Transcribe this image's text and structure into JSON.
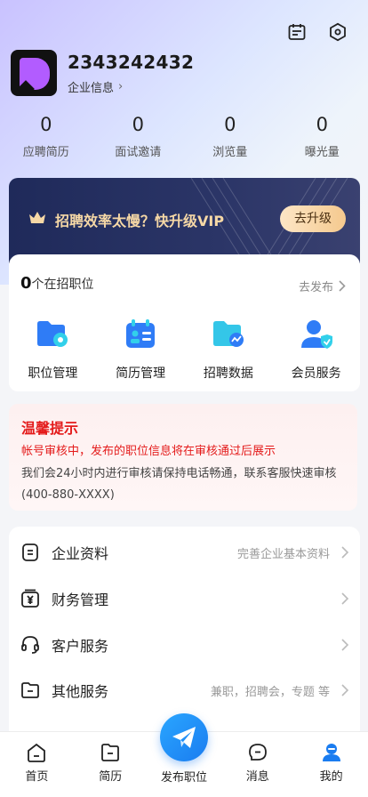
{
  "profile": {
    "company_name": "2343242432",
    "info_label": "企业信息",
    "info_chevron": "›"
  },
  "header_icons": [
    "calendar-icon",
    "settings-hexagon-icon"
  ],
  "stats": [
    {
      "value": "0",
      "label": "应聘简历"
    },
    {
      "value": "0",
      "label": "面试邀请"
    },
    {
      "value": "0",
      "label": "浏览量"
    },
    {
      "value": "0",
      "label": "曝光量"
    }
  ],
  "vip_banner": {
    "text": "招聘效率太慢？快升级VIP",
    "button": "去升级",
    "icon": "crown-icon"
  },
  "jobs": {
    "count": "0",
    "count_suffix": "个在招职位",
    "publish_link": "去发布",
    "entries": [
      {
        "label": "职位管理",
        "icon": "folder-settings-icon"
      },
      {
        "label": "简历管理",
        "icon": "resume-calendar-icon"
      },
      {
        "label": "招聘数据",
        "icon": "folder-chart-icon"
      },
      {
        "label": "会员服务",
        "icon": "user-shield-icon"
      }
    ]
  },
  "notice": {
    "title": "温馨提示",
    "warning": "帐号审核中，发布的职位信息将在审核通过后展示",
    "body": "我们会24小时内进行审核请保持电话畅通，联系客服快速审核(400-880-XXXX)"
  },
  "menu": [
    {
      "label": "企业资料",
      "hint": "完善企业基本资料",
      "icon": "document-icon"
    },
    {
      "label": "财务管理",
      "hint": "",
      "icon": "yuan-wallet-icon"
    },
    {
      "label": "客户服务",
      "hint": "",
      "icon": "headset-icon"
    },
    {
      "label": "其他服务",
      "hint": "兼职，招聘会，专题 等",
      "icon": "folder-minus-icon"
    }
  ],
  "tabbar": [
    {
      "label": "首页",
      "icon": "home-icon"
    },
    {
      "label": "简历",
      "icon": "resume-icon"
    },
    {
      "label": "发布职位",
      "icon": "paper-plane-icon"
    },
    {
      "label": "消息",
      "icon": "message-icon"
    },
    {
      "label": "我的",
      "icon": "profile-icon",
      "active": true
    }
  ],
  "colors": {
    "accent_blue": "#1a7cf0",
    "vip_gold": "#f6d8a6",
    "vip_bg": "#1f2a5a",
    "warning_red": "#e41b1b"
  }
}
